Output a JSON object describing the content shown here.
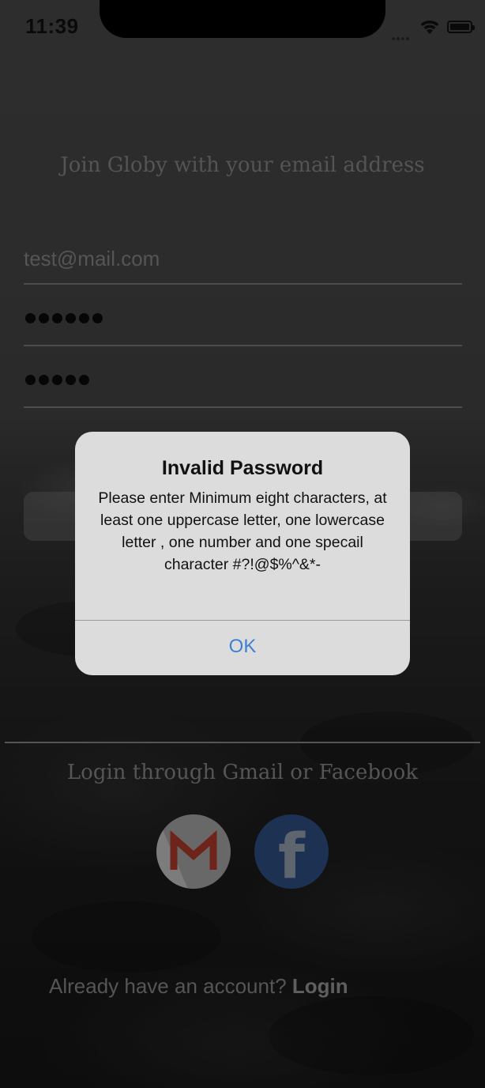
{
  "status_bar": {
    "time": "11:39"
  },
  "heading": "Join Globy with your email address",
  "form": {
    "email_value": "test@mail.com",
    "password_dots": 6,
    "confirm_password_dots": 5
  },
  "alert": {
    "title": "Invalid Password",
    "message": "Please enter Minimum eight characters, at least one uppercase letter, one lowercase letter , one number and one specail character #?!@$%^&*-",
    "ok_label": "OK",
    "ok_color": "#3e7fd6"
  },
  "social": {
    "text": "Login through Gmail or Facebook",
    "gmail_icon": "gmail-icon",
    "facebook_icon": "facebook-icon"
  },
  "footer": {
    "prompt": "Already have an account?",
    "login_label": "Login"
  }
}
